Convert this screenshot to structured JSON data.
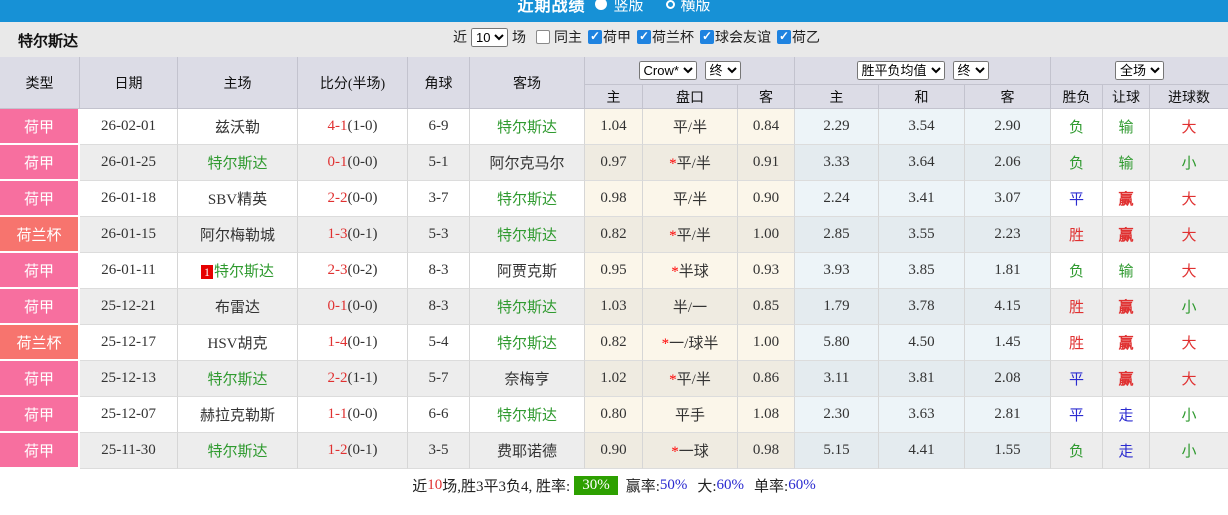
{
  "topbar": {
    "title": "近期战绩",
    "vertical": "竖版",
    "horizontal": "横版"
  },
  "filterbar": {
    "team": "特尔斯达",
    "near": "近",
    "near_value": "10",
    "field": "场",
    "same_home": "同主",
    "leagues": [
      "荷甲",
      "荷兰杯",
      "球会友谊",
      "荷乙"
    ]
  },
  "table": {
    "headers": {
      "type": "类型",
      "date": "日期",
      "home": "主场",
      "score": "比分(半场)",
      "corner": "角球",
      "away": "客场",
      "sub": [
        "主",
        "盘口",
        "客",
        "主",
        "和",
        "客",
        "胜负",
        "让球",
        "进球数"
      ]
    },
    "selects": {
      "company": "Crow*",
      "company_stage": "终",
      "average": "胜平负均值",
      "average_stage": "终",
      "scope": "全场"
    },
    "rows": [
      {
        "league": "荷甲",
        "league_style": "pink",
        "date": "26-02-01",
        "home": "兹沃勒",
        "home_green": false,
        "home_badge": "",
        "score": "4-1",
        "half": "(1-0)",
        "corner": "6-9",
        "away": "特尔斯达",
        "away_green": true,
        "home_odds": "1.04",
        "handicap": "平/半",
        "handicap_star": false,
        "away_odds": "0.84",
        "avg_win": "2.29",
        "avg_draw": "3.54",
        "avg_lose": "2.90",
        "result": [
          "负",
          "lose"
        ],
        "handicap_result": [
          "输",
          "lose"
        ],
        "goals": [
          "大",
          "win"
        ]
      },
      {
        "league": "荷甲",
        "league_style": "pink",
        "date": "26-01-25",
        "home": "特尔斯达",
        "home_green": true,
        "home_badge": "",
        "score": "0-1",
        "half": "(0-0)",
        "corner": "5-1",
        "away": "阿尔克马尔",
        "away_green": false,
        "home_odds": "0.97",
        "handicap": "平/半",
        "handicap_star": true,
        "away_odds": "0.91",
        "avg_win": "3.33",
        "avg_draw": "3.64",
        "avg_lose": "2.06",
        "result": [
          "负",
          "lose"
        ],
        "handicap_result": [
          "输",
          "lose"
        ],
        "goals": [
          "小",
          "lose"
        ]
      },
      {
        "league": "荷甲",
        "league_style": "pink",
        "date": "26-01-18",
        "home": "SBV精英",
        "home_green": false,
        "home_badge": "",
        "score": "2-2",
        "half": "(0-0)",
        "corner": "3-7",
        "away": "特尔斯达",
        "away_green": true,
        "home_odds": "0.98",
        "handicap": "平/半",
        "handicap_star": false,
        "away_odds": "0.90",
        "avg_win": "2.24",
        "avg_draw": "3.41",
        "avg_lose": "3.07",
        "result": [
          "平",
          "draw"
        ],
        "handicap_result": [
          "赢",
          "win"
        ],
        "goals": [
          "大",
          "win"
        ]
      },
      {
        "league": "荷兰杯",
        "league_style": "salmon",
        "date": "26-01-15",
        "home": "阿尔梅勒城",
        "home_green": false,
        "home_badge": "",
        "score": "1-3",
        "half": "(0-1)",
        "corner": "5-3",
        "away": "特尔斯达",
        "away_green": true,
        "home_odds": "0.82",
        "handicap": "平/半",
        "handicap_star": true,
        "away_odds": "1.00",
        "avg_win": "2.85",
        "avg_draw": "3.55",
        "avg_lose": "2.23",
        "result": [
          "胜",
          "win"
        ],
        "handicap_result": [
          "赢",
          "win"
        ],
        "goals": [
          "大",
          "win"
        ]
      },
      {
        "league": "荷甲",
        "league_style": "pink",
        "date": "26-01-11",
        "home": "特尔斯达",
        "home_green": true,
        "home_badge": "1",
        "score": "2-3",
        "half": "(0-2)",
        "corner": "8-3",
        "away": "阿贾克斯",
        "away_green": false,
        "home_odds": "0.95",
        "handicap": "半球",
        "handicap_star": true,
        "away_odds": "0.93",
        "avg_win": "3.93",
        "avg_draw": "3.85",
        "avg_lose": "1.81",
        "result": [
          "负",
          "lose"
        ],
        "handicap_result": [
          "输",
          "lose"
        ],
        "goals": [
          "大",
          "win"
        ]
      },
      {
        "league": "荷甲",
        "league_style": "pink",
        "date": "25-12-21",
        "home": "布雷达",
        "home_green": false,
        "home_badge": "",
        "score": "0-1",
        "half": "(0-0)",
        "corner": "8-3",
        "away": "特尔斯达",
        "away_green": true,
        "home_odds": "1.03",
        "handicap": "半/一",
        "handicap_star": false,
        "away_odds": "0.85",
        "avg_win": "1.79",
        "avg_draw": "3.78",
        "avg_lose": "4.15",
        "result": [
          "胜",
          "win"
        ],
        "handicap_result": [
          "赢",
          "win"
        ],
        "goals": [
          "小",
          "lose"
        ]
      },
      {
        "league": "荷兰杯",
        "league_style": "salmon",
        "date": "25-12-17",
        "home": "HSV胡克",
        "home_green": false,
        "home_badge": "",
        "score": "1-4",
        "half": "(0-1)",
        "corner": "5-4",
        "away": "特尔斯达",
        "away_green": true,
        "home_odds": "0.82",
        "handicap": "一/球半",
        "handicap_star": true,
        "away_odds": "1.00",
        "avg_win": "5.80",
        "avg_draw": "4.50",
        "avg_lose": "1.45",
        "result": [
          "胜",
          "win"
        ],
        "handicap_result": [
          "赢",
          "win"
        ],
        "goals": [
          "大",
          "win"
        ]
      },
      {
        "league": "荷甲",
        "league_style": "pink",
        "date": "25-12-13",
        "home": "特尔斯达",
        "home_green": true,
        "home_badge": "",
        "score": "2-2",
        "half": "(1-1)",
        "corner": "5-7",
        "away": "奈梅亨",
        "away_green": false,
        "home_odds": "1.02",
        "handicap": "平/半",
        "handicap_star": true,
        "away_odds": "0.86",
        "avg_win": "3.11",
        "avg_draw": "3.81",
        "avg_lose": "2.08",
        "result": [
          "平",
          "draw"
        ],
        "handicap_result": [
          "赢",
          "win"
        ],
        "goals": [
          "大",
          "win"
        ]
      },
      {
        "league": "荷甲",
        "league_style": "pink",
        "date": "25-12-07",
        "home": "赫拉克勒斯",
        "home_green": false,
        "home_badge": "",
        "score": "1-1",
        "half": "(0-0)",
        "corner": "6-6",
        "away": "特尔斯达",
        "away_green": true,
        "home_odds": "0.80",
        "handicap": "平手",
        "handicap_star": false,
        "away_odds": "1.08",
        "avg_win": "2.30",
        "avg_draw": "3.63",
        "avg_lose": "2.81",
        "result": [
          "平",
          "draw"
        ],
        "handicap_result": [
          "走",
          "draw"
        ],
        "goals": [
          "小",
          "lose"
        ]
      },
      {
        "league": "荷甲",
        "league_style": "pink",
        "date": "25-11-30",
        "home": "特尔斯达",
        "home_green": true,
        "home_badge": "",
        "score": "1-2",
        "half": "(0-1)",
        "corner": "3-5",
        "away": "费耶诺德",
        "away_green": false,
        "home_odds": "0.90",
        "handicap": "一球",
        "handicap_star": true,
        "away_odds": "0.98",
        "avg_win": "5.15",
        "avg_draw": "4.41",
        "avg_lose": "1.55",
        "result": [
          "负",
          "lose"
        ],
        "handicap_result": [
          "走",
          "draw"
        ],
        "goals": [
          "小",
          "lose"
        ]
      }
    ]
  },
  "footer": {
    "part1": "近",
    "count": "10",
    "part2": "场,胜3平3负4, 胜率:",
    "win_rate": "30%",
    "odds_win_label": "赢率:",
    "odds_win": "50%",
    "big_label": "大:",
    "big": "60%",
    "single_label": "单率:",
    "single": "60%"
  },
  "colors": {
    "topbar-blue": "#1791d6",
    "check-blue": "#1f83e0",
    "pink": "#f76f9f",
    "salmon": "#f7746e",
    "green": "#2f9a2f",
    "red": "#e03131",
    "blue": "#2b2bd0",
    "rate-green": "#2da000"
  }
}
